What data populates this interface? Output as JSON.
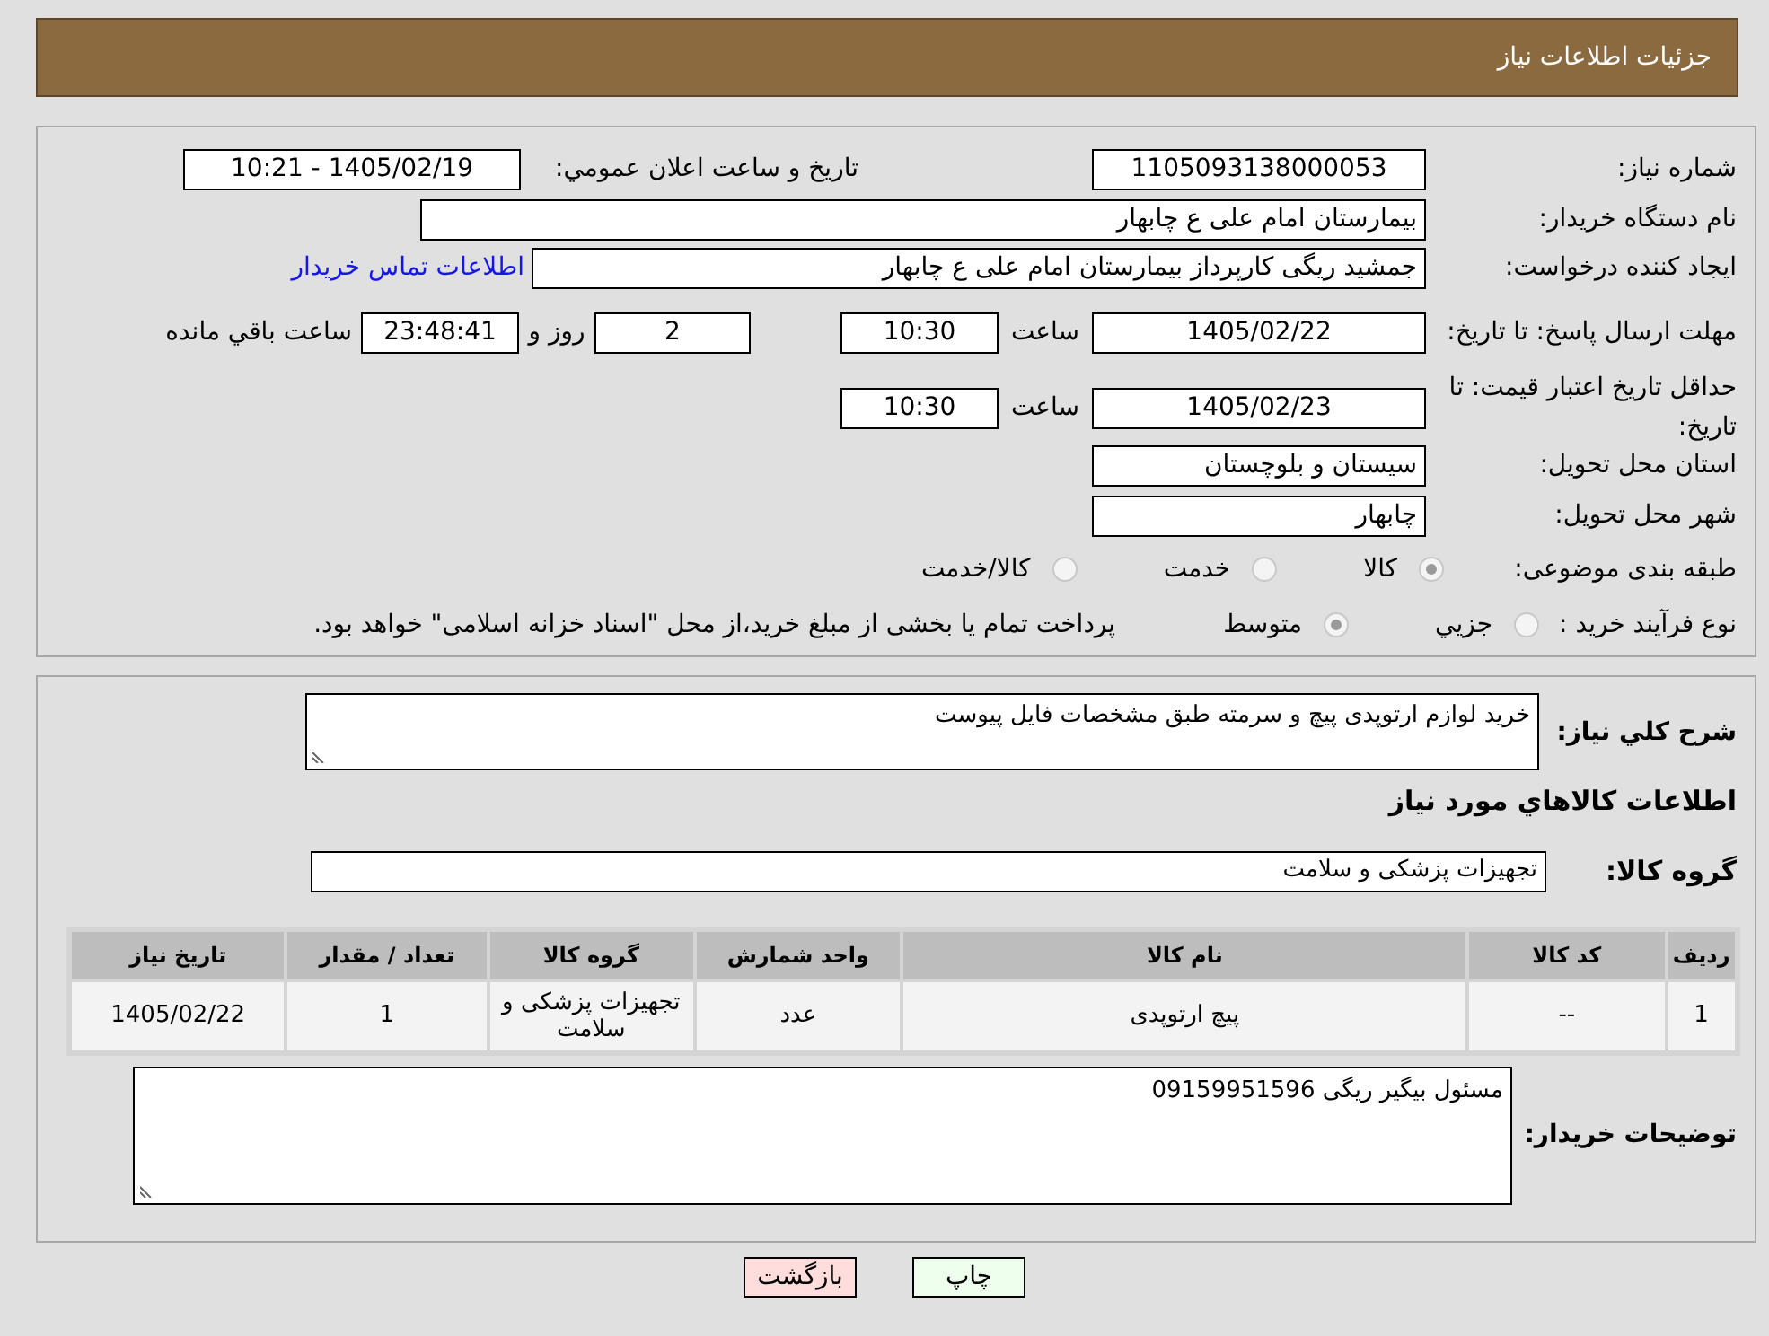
{
  "header": {
    "title": "جزئیات اطلاعات نیاز"
  },
  "details": {
    "need_number": {
      "label": "شماره نیاز:",
      "value": "1105093138000053"
    },
    "announce": {
      "label": "تاريخ و ساعت اعلان عمومي:",
      "value": "1405/02/19 - 10:21"
    },
    "buyer_org": {
      "label": "نام دستگاه خریدار:",
      "value": "بیمارستان امام علی  ع  چابهار"
    },
    "requester": {
      "label": "ایجاد کننده درخواست:",
      "value": "جمشید ریگی کارپرداز بیمارستان امام علی  ع  چابهار",
      "link": "اطلاعات تماس خریدار"
    },
    "reply_deadline": {
      "label": "مهلت ارسال پاسخ: تا تاریخ:",
      "date": "1405/02/22",
      "time_label": "ساعت",
      "time": "10:30",
      "days": "2",
      "days_label": "روز و",
      "remaining": "23:48:41",
      "remaining_label": "ساعت باقي مانده"
    },
    "price_validity": {
      "label": "حداقل تاریخ اعتبار قیمت: تا تاریخ:",
      "date": "1405/02/23",
      "time_label": "ساعت",
      "time": "10:30"
    },
    "province": {
      "label": "استان محل تحویل:",
      "value": "سیستان و بلوچستان"
    },
    "city": {
      "label": "شهر محل تحویل:",
      "value": "چابهار"
    },
    "category": {
      "label": "طبقه بندی موضوعی:",
      "options": [
        {
          "label": "کالا",
          "selected": true
        },
        {
          "label": "خدمت",
          "selected": false
        },
        {
          "label": "کالا/خدمت",
          "selected": false
        }
      ]
    },
    "process": {
      "label": "نوع فرآیند خرید :",
      "options": [
        {
          "label": "جزيي",
          "selected": false
        },
        {
          "label": "متوسط",
          "selected": true
        }
      ],
      "note": "پرداخت تمام یا بخشی از مبلغ خرید،از محل \"اسناد خزانه اسلامی\" خواهد بود."
    }
  },
  "goods": {
    "description": {
      "label": "شرح کلي نیاز:",
      "value": "خرید لوازم ارتوپدی پیچ و سرمته طبق مشخصات فایل پیوست"
    },
    "title": "اطلاعات کالاهاي مورد نیاز",
    "group": {
      "label": "گروه کالا:",
      "value": "تجهیزات پزشکی و سلامت"
    },
    "table": {
      "columns": [
        "ردیف",
        "کد کالا",
        "نام کالا",
        "واحد شمارش",
        "گروه کالا",
        "تعداد / مقدار",
        "تاریخ نیاز"
      ],
      "rows": [
        [
          "1",
          "--",
          "پیچ ارتوپدی",
          "عدد",
          "تجهیزات پزشکی و سلامت",
          "1",
          "1405/02/22"
        ]
      ]
    },
    "notes": {
      "label": "توضیحات خریدار:",
      "value": "مسئول بیگیر ریگی 09159951596"
    }
  },
  "buttons": [
    {
      "label": "چاپ",
      "kind": "print"
    },
    {
      "label": "بازگشت",
      "kind": "back"
    }
  ]
}
